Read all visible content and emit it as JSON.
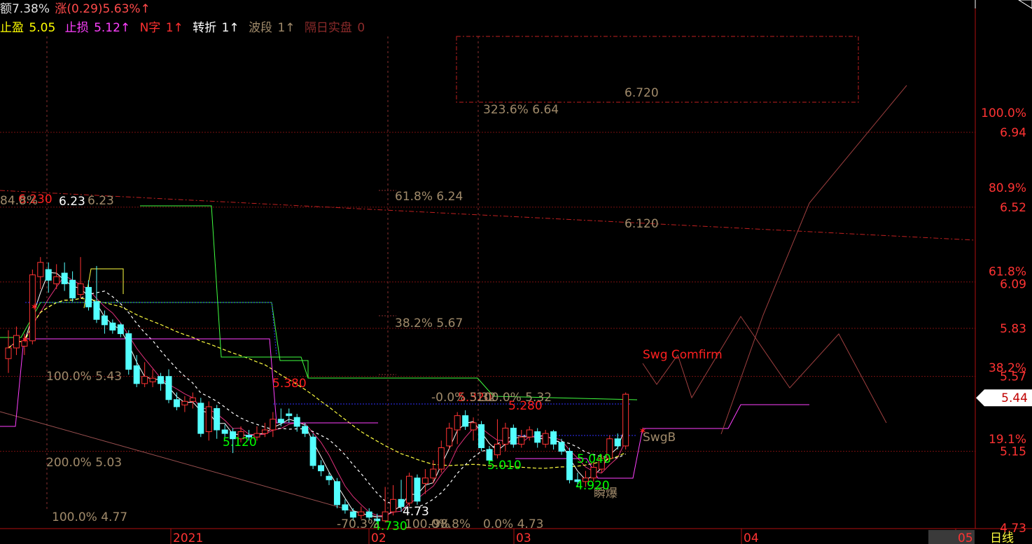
{
  "header": {
    "line1": [
      {
        "text": "额7.38%",
        "color": "#e0e0e0"
      },
      {
        "text": "涨(0.29)5.63%↑",
        "color": "#ff4a4a"
      }
    ],
    "line2": [
      {
        "text": "止盈",
        "color": "#ffff00"
      },
      {
        "text": "5.05",
        "color": "#ffff00"
      },
      {
        "text": "止损",
        "color": "#ff40ff"
      },
      {
        "text": "5.12↑",
        "color": "#ff40ff"
      },
      {
        "text": "N字",
        "color": "#ff3030"
      },
      {
        "text": "1↑",
        "color": "#ff3030"
      },
      {
        "text": "转折",
        "color": "#ffffff"
      },
      {
        "text": "1↑",
        "color": "#ffffff"
      },
      {
        "text": "波段",
        "color": "#a08a6a"
      },
      {
        "text": "1↑",
        "color": "#a08a6a"
      },
      {
        "text": "隔日实盘",
        "color": "#8b2a2a"
      },
      {
        "text": "0",
        "color": "#8b2a2a"
      }
    ]
  },
  "chart_data": {
    "type": "candlestick",
    "period": "日线",
    "ylim": [
      4.66,
      7.08
    ],
    "y_ticks": [
      {
        "label": "100.0%",
        "value": 7.04
      },
      {
        "label": "6.94",
        "value": 6.93
      },
      {
        "label": "80.9%",
        "value": 6.62
      },
      {
        "label": "6.52",
        "value": 6.51
      },
      {
        "label": "61.8%",
        "value": 6.15
      },
      {
        "label": "6.09",
        "value": 6.08
      },
      {
        "label": "5.83",
        "value": 5.83
      },
      {
        "label": "38.2%",
        "value": 5.61
      },
      {
        "label": "5.57",
        "value": 5.56
      },
      {
        "label": "19.1%",
        "value": 5.21
      },
      {
        "label": "5.15",
        "value": 5.14
      },
      {
        "label": "4.73",
        "value": 4.71
      }
    ],
    "current_price": "5.44",
    "x_ticks": [
      "2021",
      "02",
      "03",
      "04",
      "05"
    ],
    "candles": [
      {
        "o": 5.66,
        "c": 5.72,
        "h": 5.82,
        "l": 5.58
      },
      {
        "o": 5.72,
        "c": 5.79,
        "h": 5.84,
        "l": 5.68
      },
      {
        "o": 5.73,
        "c": 5.76,
        "h": 5.8,
        "l": 5.68
      },
      {
        "o": 5.76,
        "c": 6.13,
        "h": 6.16,
        "l": 5.74
      },
      {
        "o": 6.12,
        "c": 6.2,
        "h": 6.23,
        "l": 6.05
      },
      {
        "o": 6.16,
        "c": 6.1,
        "h": 6.2,
        "l": 6.03
      },
      {
        "o": 6.08,
        "c": 6.12,
        "h": 6.19,
        "l": 6.05
      },
      {
        "o": 6.14,
        "c": 6.08,
        "h": 6.2,
        "l": 6.04
      },
      {
        "o": 6.1,
        "c": 6.0,
        "h": 6.15,
        "l": 5.98
      },
      {
        "o": 6.02,
        "c": 6.08,
        "h": 6.23,
        "l": 6.0
      },
      {
        "o": 6.06,
        "c": 5.95,
        "h": 6.1,
        "l": 5.93
      },
      {
        "o": 5.98,
        "c": 5.88,
        "h": 6.18,
        "l": 5.86
      },
      {
        "o": 5.9,
        "c": 5.85,
        "h": 5.93,
        "l": 5.8
      },
      {
        "o": 5.86,
        "c": 5.82,
        "h": 5.88,
        "l": 5.8
      },
      {
        "o": 5.85,
        "c": 5.8,
        "h": 5.86,
        "l": 5.78
      },
      {
        "o": 5.8,
        "c": 5.6,
        "h": 5.82,
        "l": 5.57
      },
      {
        "o": 5.62,
        "c": 5.52,
        "h": 5.68,
        "l": 5.5
      },
      {
        "o": 5.52,
        "c": 5.56,
        "h": 5.64,
        "l": 5.5
      },
      {
        "o": 5.53,
        "c": 5.55,
        "h": 5.6,
        "l": 5.5
      },
      {
        "o": 5.56,
        "c": 5.52,
        "h": 5.58,
        "l": 5.48
      },
      {
        "o": 5.56,
        "c": 5.43,
        "h": 5.6,
        "l": 5.41
      },
      {
        "o": 5.43,
        "c": 5.39,
        "h": 5.47,
        "l": 5.37
      },
      {
        "o": 5.4,
        "c": 5.42,
        "h": 5.45,
        "l": 5.36
      },
      {
        "o": 5.42,
        "c": 5.44,
        "h": 5.47,
        "l": 5.38
      },
      {
        "o": 5.41,
        "c": 5.24,
        "h": 5.44,
        "l": 5.22
      },
      {
        "o": 5.25,
        "c": 5.39,
        "h": 5.42,
        "l": 5.2
      },
      {
        "o": 5.38,
        "c": 5.26,
        "h": 5.4,
        "l": 5.21
      },
      {
        "o": 5.26,
        "c": 5.24,
        "h": 5.29,
        "l": 5.22
      },
      {
        "o": 5.25,
        "c": 5.21,
        "h": 5.27,
        "l": 5.13
      },
      {
        "o": 5.21,
        "c": 5.25,
        "h": 5.28,
        "l": 5.19
      },
      {
        "o": 5.23,
        "c": 5.22,
        "h": 5.26,
        "l": 5.2
      },
      {
        "o": 5.22,
        "c": 5.24,
        "h": 5.28,
        "l": 5.2
      },
      {
        "o": 5.24,
        "c": 5.26,
        "h": 5.3,
        "l": 5.22
      },
      {
        "o": 5.26,
        "c": 5.32,
        "h": 5.36,
        "l": 5.22
      },
      {
        "o": 5.32,
        "c": 5.3,
        "h": 5.38,
        "l": 5.28
      },
      {
        "o": 5.35,
        "c": 5.34,
        "h": 5.38,
        "l": 5.3
      },
      {
        "o": 5.33,
        "c": 5.28,
        "h": 5.35,
        "l": 5.25
      },
      {
        "o": 5.28,
        "c": 5.24,
        "h": 5.3,
        "l": 5.22
      },
      {
        "o": 5.22,
        "c": 5.06,
        "h": 5.24,
        "l": 5.04
      },
      {
        "o": 5.06,
        "c": 5.03,
        "h": 5.09,
        "l": 5.0
      },
      {
        "o": 5.0,
        "c": 4.98,
        "h": 5.02,
        "l": 4.95
      },
      {
        "o": 4.97,
        "c": 4.84,
        "h": 4.99,
        "l": 4.82
      },
      {
        "o": 4.84,
        "c": 4.81,
        "h": 4.87,
        "l": 4.79
      },
      {
        "o": 4.8,
        "c": 4.77,
        "h": 4.82,
        "l": 4.75
      },
      {
        "o": 4.78,
        "c": 4.8,
        "h": 4.83,
        "l": 4.76
      },
      {
        "o": 4.8,
        "c": 4.77,
        "h": 4.82,
        "l": 4.75
      },
      {
        "o": 4.76,
        "c": 4.75,
        "h": 4.79,
        "l": 4.73
      },
      {
        "o": 4.75,
        "c": 4.8,
        "h": 4.94,
        "l": 4.74
      },
      {
        "o": 4.8,
        "c": 4.87,
        "h": 4.95,
        "l": 4.78
      },
      {
        "o": 4.87,
        "c": 4.83,
        "h": 4.98,
        "l": 4.8
      },
      {
        "o": 4.85,
        "c": 5.0,
        "h": 5.02,
        "l": 4.83
      },
      {
        "o": 4.99,
        "c": 4.86,
        "h": 5.01,
        "l": 4.84
      },
      {
        "o": 4.96,
        "c": 4.99,
        "h": 5.04,
        "l": 4.9
      },
      {
        "o": 4.99,
        "c": 5.04,
        "h": 5.09,
        "l": 4.96
      },
      {
        "o": 5.04,
        "c": 5.16,
        "h": 5.2,
        "l": 5.02
      },
      {
        "o": 5.17,
        "c": 5.27,
        "h": 5.3,
        "l": 5.15
      },
      {
        "o": 5.26,
        "c": 5.34,
        "h": 5.36,
        "l": 5.18
      },
      {
        "o": 5.34,
        "c": 5.28,
        "h": 5.37,
        "l": 5.26
      },
      {
        "o": 5.26,
        "c": 5.3,
        "h": 5.33,
        "l": 5.2
      },
      {
        "o": 5.29,
        "c": 5.16,
        "h": 5.31,
        "l": 5.14
      },
      {
        "o": 5.15,
        "c": 5.09,
        "h": 5.17,
        "l": 5.07
      },
      {
        "o": 5.12,
        "c": 5.18,
        "h": 5.32,
        "l": 5.1
      },
      {
        "o": 5.18,
        "c": 5.27,
        "h": 5.3,
        "l": 5.14
      },
      {
        "o": 5.27,
        "c": 5.18,
        "h": 5.29,
        "l": 5.16
      },
      {
        "o": 5.18,
        "c": 5.22,
        "h": 5.26,
        "l": 5.16
      },
      {
        "o": 5.22,
        "c": 5.26,
        "h": 5.28,
        "l": 5.2
      },
      {
        "o": 5.25,
        "c": 5.19,
        "h": 5.27,
        "l": 5.16
      },
      {
        "o": 5.18,
        "c": 5.24,
        "h": 5.26,
        "l": 5.16
      },
      {
        "o": 5.25,
        "c": 5.18,
        "h": 5.26,
        "l": 5.15
      },
      {
        "o": 5.19,
        "c": 5.14,
        "h": 5.21,
        "l": 5.12
      },
      {
        "o": 5.14,
        "c": 4.98,
        "h": 5.16,
        "l": 4.96
      },
      {
        "o": 4.98,
        "c": 4.97,
        "h": 5.02,
        "l": 4.94
      },
      {
        "o": 4.97,
        "c": 4.99,
        "h": 5.03,
        "l": 4.94
      },
      {
        "o": 4.99,
        "c": 5.05,
        "h": 5.08,
        "l": 4.97
      },
      {
        "o": 5.04,
        "c": 5.1,
        "h": 5.12,
        "l": 5.02
      },
      {
        "o": 5.1,
        "c": 5.21,
        "h": 5.23,
        "l": 5.08
      },
      {
        "o": 5.21,
        "c": 5.17,
        "h": 5.24,
        "l": 5.15
      },
      {
        "o": 5.17,
        "c": 5.46,
        "h": 5.47,
        "l": 5.15
      }
    ],
    "annotations": [
      {
        "text": "Swg Comfirm",
        "color": "#ff2020"
      },
      {
        "text": "SwgB",
        "color": "#a08a6a"
      },
      {
        "text": "瞬爆",
        "color": "#a08a6a"
      },
      {
        "text": "5.120",
        "color": "#00ff00"
      },
      {
        "text": "5.010",
        "color": "#00ff00"
      },
      {
        "text": "4.920",
        "color": "#00ff00"
      },
      {
        "text": "5.040",
        "color": "#00ff00"
      },
      {
        "text": "5.380",
        "color": "#ff2020"
      },
      {
        "text": "5.320",
        "color": "#ff2020"
      },
      {
        "text": "5.280",
        "color": "#ff2020"
      },
      {
        "text": "6.230",
        "color": "#ff2020"
      },
      {
        "text": "6.23",
        "color": "#ffffff"
      },
      {
        "text": "4.73",
        "color": "#ffffff"
      },
      {
        "text": "4.730",
        "color": "#00ff00"
      },
      {
        "text": "6.720",
        "color": "#a08a6a"
      },
      {
        "text": "6.120",
        "color": "#a08a6a"
      },
      {
        "text": "323.6% 6.64",
        "color": "#a08a6a"
      },
      {
        "text": "61.8% 6.24",
        "color": "#a08a6a"
      },
      {
        "text": "38.2% 5.67",
        "color": "#a08a6a"
      },
      {
        "text": "100.0% 5.43",
        "color": "#a08a6a"
      },
      {
        "text": "200.0% 5.03",
        "color": "#a08a6a"
      },
      {
        "text": "100.0% 4.77",
        "color": "#a08a6a"
      },
      {
        "text": "0.0% 4.73",
        "color": "#a08a6a"
      },
      {
        "text": "-0.0% 5.32",
        "color": "#a08a6a"
      },
      {
        "text": "100.0% 5.32",
        "color": "#a08a6a"
      },
      {
        "text": "84.8%",
        "color": "#a08a6a"
      },
      {
        "text": "6.23",
        "color": "#a08a6a"
      },
      {
        "text": "-70.3%",
        "color": "#a08a6a"
      },
      {
        "text": "100.0%",
        "color": "#a08a6a"
      },
      {
        "text": "-98.8%",
        "color": "#a08a6a"
      }
    ],
    "colors": {
      "up": "#ff3333",
      "down": "#54ffff",
      "grid": "#7a1010",
      "axis_label": "#ff3333",
      "fib_text": "#a08a6a"
    }
  }
}
